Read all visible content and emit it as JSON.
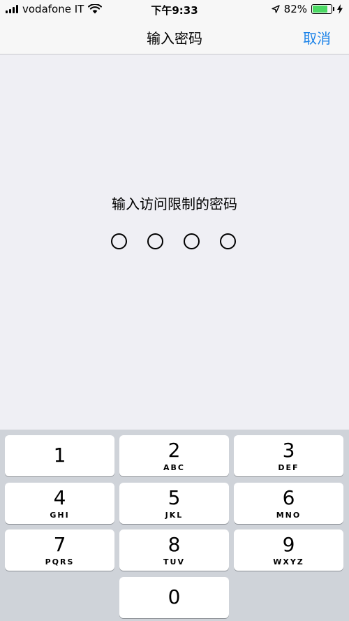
{
  "status_bar": {
    "carrier": "vodafone IT",
    "time": "下午9:33",
    "battery_percent": "82%",
    "battery_level": 0.82,
    "battery_color": "#4cd964"
  },
  "nav": {
    "title": "输入密码",
    "cancel_label": "取消",
    "accent_color": "#1a82e8"
  },
  "passcode": {
    "prompt": "输入访问限制的密码",
    "digits_total": 4,
    "digits_entered": 0
  },
  "keypad": {
    "keys": [
      {
        "number": "1",
        "letters": ""
      },
      {
        "number": "2",
        "letters": "ABC"
      },
      {
        "number": "3",
        "letters": "DEF"
      },
      {
        "number": "4",
        "letters": "GHI"
      },
      {
        "number": "5",
        "letters": "JKL"
      },
      {
        "number": "6",
        "letters": "MNO"
      },
      {
        "number": "7",
        "letters": "PQRS"
      },
      {
        "number": "8",
        "letters": "TUV"
      },
      {
        "number": "9",
        "letters": "WXYZ"
      },
      {
        "number": "0",
        "letters": ""
      }
    ]
  }
}
